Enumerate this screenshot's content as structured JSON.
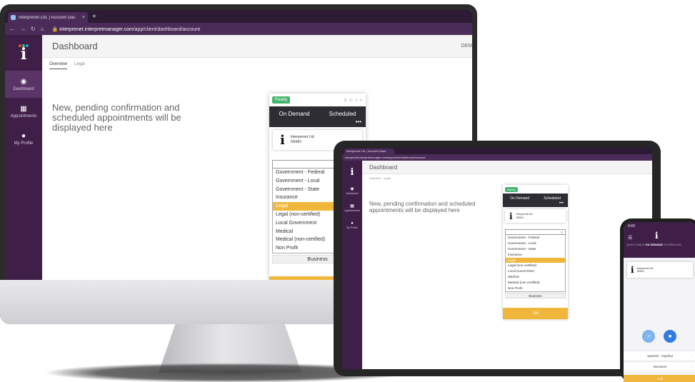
{
  "colors": {
    "brand_purple": "#3f1f48",
    "accent_yellow": "#f0b73c",
    "ready_green": "#44b36b",
    "widget_dark": "#2d2d33",
    "phone_blue": "#2f7de1",
    "phone_blue_light": "#7fb3ee"
  },
  "browser": {
    "tab_title": "Interprenet Ltd. | Account Das",
    "tab_close": "×",
    "new_tab": "+",
    "url_host": "interprenet.interpretmanager.com",
    "url_path": "/app/client/dashboard/account",
    "tablet_tab_title": "Interprenet Ltd. | Account Dash",
    "tablet_url": "interprenet.interpretmanager.com/app/client/dashboard/account"
  },
  "sidebar": {
    "logo_glyph": "i",
    "items": [
      {
        "label": "Dashboard",
        "icon": "dashboard-icon"
      },
      {
        "label": "Appointments",
        "icon": "calendar-icon"
      },
      {
        "label": "My Profile",
        "icon": "user-icon"
      }
    ]
  },
  "header": {
    "title": "Dashboard",
    "user": "DEM"
  },
  "tabs": [
    {
      "label": "Overview"
    },
    {
      "label": "Legal"
    }
  ],
  "main": {
    "pending_text": "New, pending confirmation and scheduled appointments will be displayed here"
  },
  "widget": {
    "status": "Ready",
    "tabs": [
      {
        "label": "On Demand"
      },
      {
        "label": "Scheduled"
      }
    ],
    "more": "•••",
    "org_name": "Interprenet Ltd.",
    "org_sub": "DEMO",
    "search_icon": "search-icon",
    "options": [
      "Government - Federal",
      "Government - Local",
      "Government - State",
      "Insurance",
      "Legal",
      "Legal (non-certified)",
      "Local Government",
      "Medical",
      "Medical (non-certified)",
      "Non Profit"
    ],
    "selected_option": "Legal",
    "business_select": "Business",
    "call_label": "Call"
  },
  "phone": {
    "time": "3:43",
    "tabs": [
      {
        "label": "QUICK DIALS"
      },
      {
        "label": "ON DEMAND"
      },
      {
        "label": "SCHEDULED"
      }
    ],
    "language": "Spanish - español",
    "business": "Business",
    "call_label": "Call"
  }
}
